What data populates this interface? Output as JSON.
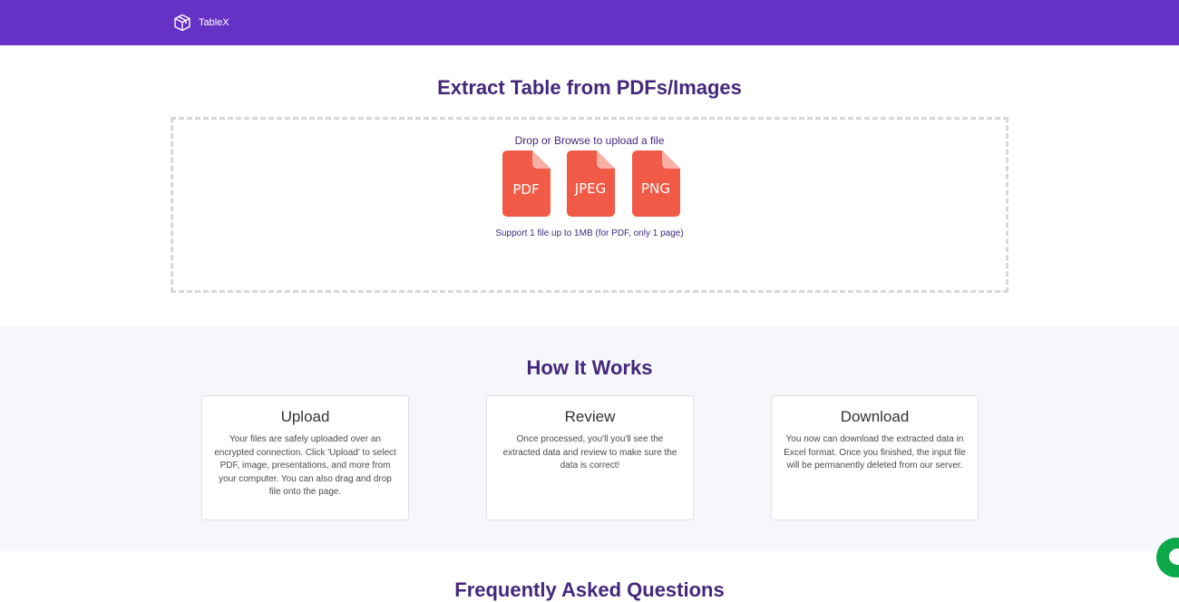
{
  "navbar": {
    "brand": "TableX",
    "logo_icon": "cube-icon",
    "color": "#6632c5"
  },
  "hero": {
    "title": "Extract Table from PDFs/Images",
    "drop_prompt": "Drop or Browse to upload a file",
    "file_types": [
      "PDF",
      "JPEG",
      "PNG"
    ],
    "file_icon_color": "#f05a46",
    "support_text": "Support 1 file up to 1MB (for PDF, only 1 page)"
  },
  "how_it_works": {
    "title": "How It Works",
    "cards": [
      {
        "title": "Upload",
        "body": "Your files are safely uploaded over an encrypted connection. Click 'Upload' to select PDF, image, presentations, and more from your computer. You can also drag and drop file onto the page."
      },
      {
        "title": "Review",
        "body": "Once processed, you'll you'll see the extracted data and review to make sure the data is correct!"
      },
      {
        "title": "Download",
        "body": "You now can download the extracted data in Excel format. Once you finished, the input file will be permanently deleted from our server."
      }
    ]
  },
  "faq": {
    "title": "Frequently Asked Questions"
  },
  "chat_widget": {
    "icon": "chat-icon",
    "color": "#0da84a"
  }
}
